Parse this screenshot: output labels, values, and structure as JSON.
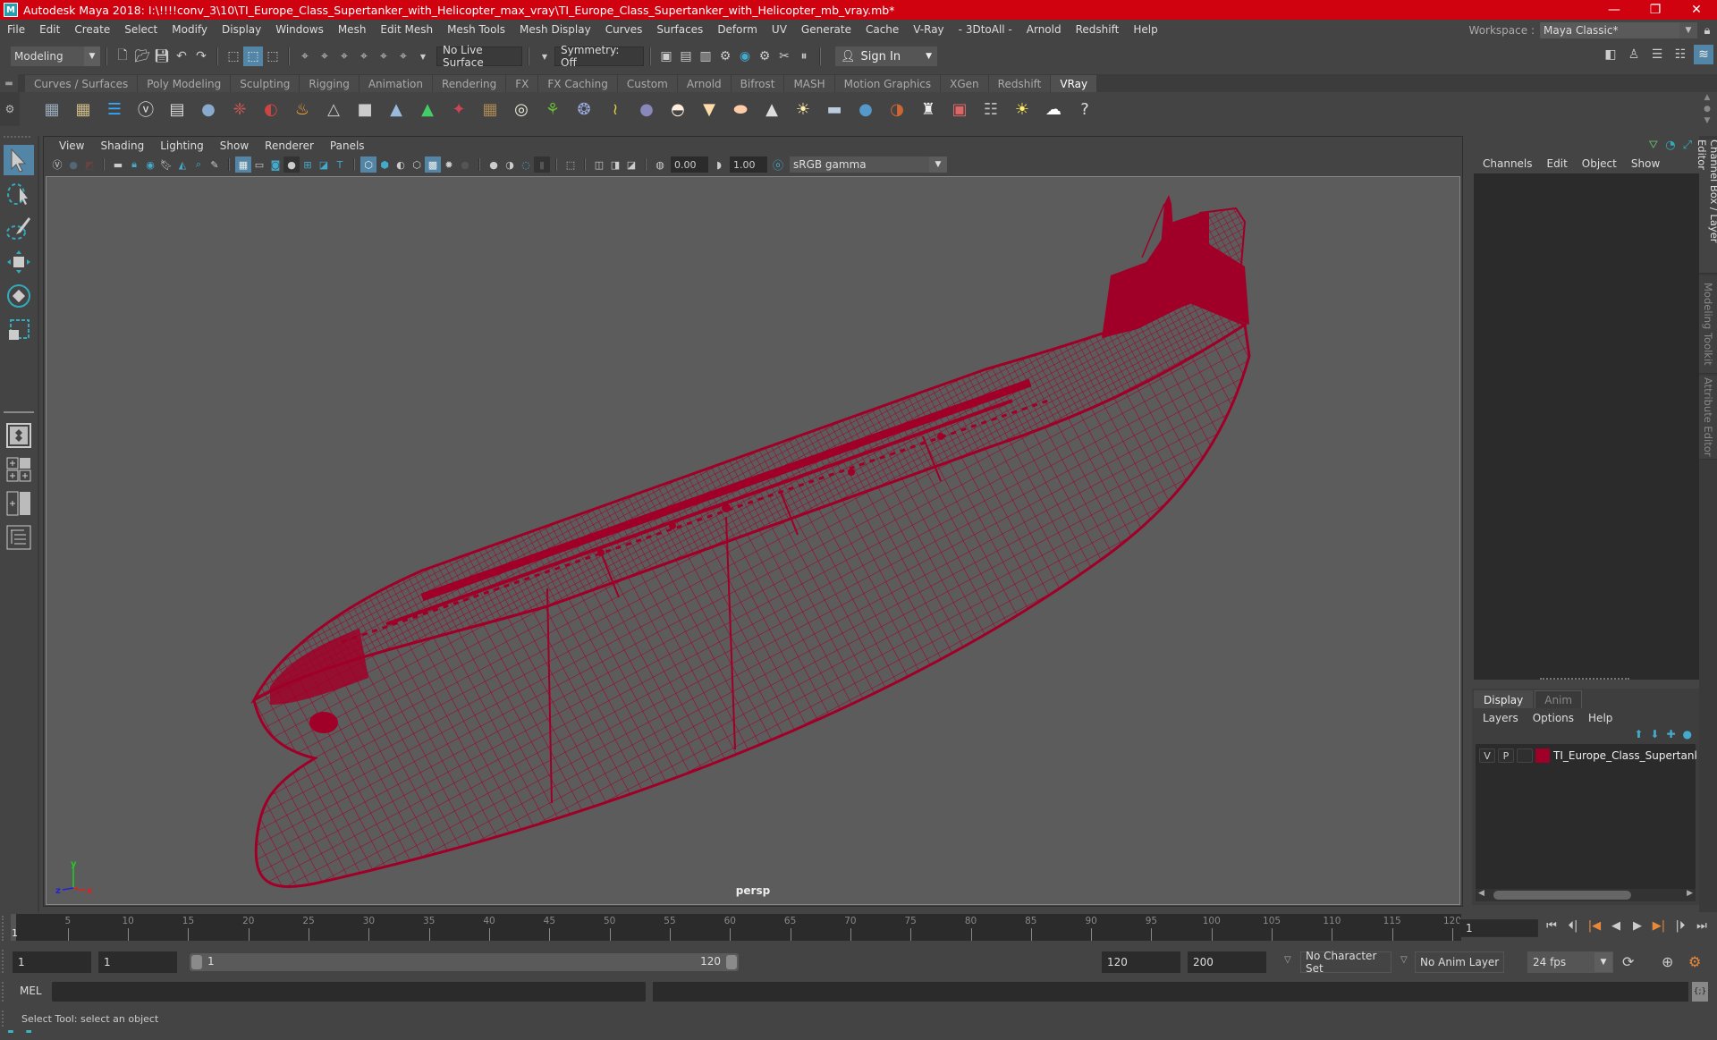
{
  "window": {
    "title": "Autodesk Maya 2018: I:\\!!!!conv_3\\10\\TI_Europe_Class_Supertanker_with_Helicopter_max_vray\\TI_Europe_Class_Supertanker_with_Helicopter_mb_vray.mb*",
    "app_icon": "M",
    "controls": {
      "minimize": "—",
      "maximize": "❐",
      "close": "✕"
    }
  },
  "menubar": {
    "items": [
      "File",
      "Edit",
      "Create",
      "Select",
      "Modify",
      "Display",
      "Windows",
      "Mesh",
      "Edit Mesh",
      "Mesh Tools",
      "Mesh Display",
      "Curves",
      "Surfaces",
      "Deform",
      "UV",
      "Generate",
      "Cache",
      "V-Ray",
      "- 3DtoAll -",
      "Arnold",
      "Redshift",
      "Help"
    ]
  },
  "workspace": {
    "label": "Workspace :",
    "value": "Maya Classic*"
  },
  "statusline": {
    "mode": "Modeling",
    "live_surface": "No Live Surface",
    "symmetry": "Symmetry: Off",
    "sign_in": "Sign In"
  },
  "shelf": {
    "tabs": [
      "Curves / Surfaces",
      "Poly Modeling",
      "Sculpting",
      "Rigging",
      "Animation",
      "Rendering",
      "FX",
      "FX Caching",
      "Custom",
      "Arnold",
      "Bifrost",
      "MASH",
      "Motion Graphics",
      "XGen",
      "Redshift",
      "VRay"
    ],
    "active_tab": "VRay",
    "icons": [
      {
        "name": "vray-cubes-save-icon",
        "color": "#9ab",
        "glyph": "▦"
      },
      {
        "name": "vray-cubes-load-icon",
        "color": "#cb8",
        "glyph": "▦"
      },
      {
        "name": "vray-hierarchy-icon",
        "color": "#3af",
        "glyph": "☰"
      },
      {
        "name": "vray-logo-icon",
        "color": "#eee",
        "glyph": "ⓥ"
      },
      {
        "name": "vray-framebuffer-icon",
        "color": "#ddd",
        "glyph": "▤"
      },
      {
        "name": "vray-sphere-light-icon",
        "color": "#8ac",
        "glyph": "●"
      },
      {
        "name": "vray-film-icon",
        "color": "#c55",
        "glyph": "❈"
      },
      {
        "name": "vray-materials-icon",
        "color": "#c44",
        "glyph": "◐"
      },
      {
        "name": "vray-fire-icon",
        "color": "#fa3",
        "glyph": "♨"
      },
      {
        "name": "vray-mesh-proxy-icon",
        "color": "#ccc",
        "glyph": "△"
      },
      {
        "name": "vray-cube-icon",
        "color": "#ccc",
        "glyph": "■"
      },
      {
        "name": "vray-drop-icon",
        "color": "#9bd",
        "glyph": "▲"
      },
      {
        "name": "vray-volume-icon",
        "color": "#4c6",
        "glyph": "▲"
      },
      {
        "name": "vray-decal-icon",
        "color": "#c45",
        "glyph": "✦"
      },
      {
        "name": "vray-tiles-icon",
        "color": "#a85",
        "glyph": "▦"
      },
      {
        "name": "vray-dome-grid-icon",
        "color": "#eed",
        "glyph": "◎"
      },
      {
        "name": "vray-fur-icon",
        "color": "#6b3",
        "glyph": "⚘"
      },
      {
        "name": "vray-scatter-icon",
        "color": "#9ad",
        "glyph": "❂"
      },
      {
        "name": "vray-curve-icon",
        "color": "#dc4",
        "glyph": "≀"
      },
      {
        "name": "vray-sphere-icon",
        "color": "#88b",
        "glyph": "●"
      },
      {
        "name": "vray-dome-light-icon",
        "color": "#fed",
        "glyph": "◓"
      },
      {
        "name": "vray-spot-light-icon",
        "color": "#fda",
        "glyph": "▼"
      },
      {
        "name": "vray-ies-light-icon",
        "color": "#fca",
        "glyph": "⬬"
      },
      {
        "name": "vray-cone-light-icon",
        "color": "#ddd",
        "glyph": "▲"
      },
      {
        "name": "vray-sun-icon",
        "color": "#fea",
        "glyph": "☀"
      },
      {
        "name": "vray-plane-light-icon",
        "color": "#bcd",
        "glyph": "▬"
      },
      {
        "name": "vray-sphere-shade-icon",
        "color": "#59c",
        "glyph": "●"
      },
      {
        "name": "vray-lens-icon",
        "color": "#c63",
        "glyph": "◑"
      },
      {
        "name": "vray-checker-icon",
        "color": "#eee",
        "glyph": "♜"
      },
      {
        "name": "vray-render-view-icon",
        "color": "#d66",
        "glyph": "▣"
      },
      {
        "name": "vray-settings-icon",
        "color": "#bbb",
        "glyph": "☷"
      },
      {
        "name": "vray-light-lister-icon",
        "color": "#fe6",
        "glyph": "☀"
      },
      {
        "name": "vray-cloud-icon",
        "color": "#fff",
        "glyph": "☁"
      },
      {
        "name": "vray-help-icon",
        "color": "#ddd",
        "glyph": "?"
      }
    ]
  },
  "viewport": {
    "menu": [
      "View",
      "Shading",
      "Lighting",
      "Show",
      "Renderer",
      "Panels"
    ],
    "exposure": "0.00",
    "gamma": "1.00",
    "color_space": "sRGB gamma",
    "camera_label": "persp",
    "wireframe_color": "#a00028",
    "axis": {
      "x": "x",
      "y": "y",
      "z": "z"
    }
  },
  "channelbox": {
    "menu": [
      "Channels",
      "Edit",
      "Object",
      "Show"
    ]
  },
  "side_tabs": [
    "Channel Box / Layer Editor",
    "Modeling Toolkit",
    "Attribute Editor"
  ],
  "layer_editor": {
    "tabs": [
      "Display",
      "Anim"
    ],
    "active_tab": "Display",
    "menu": [
      "Layers",
      "Options",
      "Help"
    ],
    "layers": [
      {
        "visible": "V",
        "playback": "P",
        "name": "TI_Europe_Class_Supertanker_",
        "color": "#a00028"
      }
    ]
  },
  "timeline": {
    "ticks": [
      5,
      10,
      15,
      20,
      25,
      30,
      35,
      40,
      45,
      50,
      55,
      60,
      65,
      70,
      75,
      80,
      85,
      90,
      95,
      100,
      105,
      110,
      115,
      120
    ],
    "min": 1,
    "max": 120,
    "current_frame": "1",
    "current_frame_field": "1"
  },
  "range": {
    "start": "1",
    "anim_start": "1",
    "range_start_label": "1",
    "range_end_label": "120",
    "end": "120",
    "anim_end": "200",
    "character_set": "No Character Set",
    "anim_layer": "No Anim Layer",
    "fps": "24 fps"
  },
  "commandline": {
    "label": "MEL"
  },
  "helpline": {
    "text": "Select Tool: select an object"
  }
}
